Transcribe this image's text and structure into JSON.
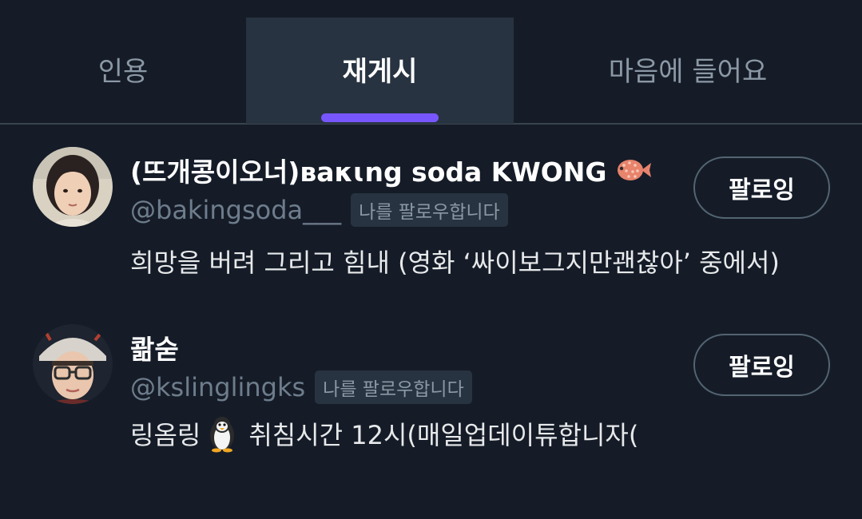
{
  "tabs": [
    {
      "label": "인용",
      "active": false
    },
    {
      "label": "재게시",
      "active": true
    },
    {
      "label": "마음에 들어요",
      "active": false
    }
  ],
  "accent_color": "#7856ff",
  "users": [
    {
      "display_name": "(뜨개콩이오너)ʙaκɩng soda KWONG",
      "name_emoji": "blowfish-emoji",
      "handle": "@bakingsoda___",
      "follows_you_label": "나를 팔로우합니다",
      "bio_before": "희망을 버려 그리고 힘내 (영화 ‘싸이보그지만괜찮아’ 중에서)",
      "bio_emoji": "",
      "bio_after": "",
      "follow_button_label": "팔로잉"
    },
    {
      "display_name": "콺숟",
      "name_emoji": "",
      "handle": "@kslinglingks",
      "follows_you_label": "나를 팔로우합니다",
      "bio_before": "링옴링",
      "bio_emoji": "penguin-emoji",
      "bio_after": "취침시간 12시(매일업데이튜합니자(",
      "follow_button_label": "팔로잉"
    }
  ]
}
